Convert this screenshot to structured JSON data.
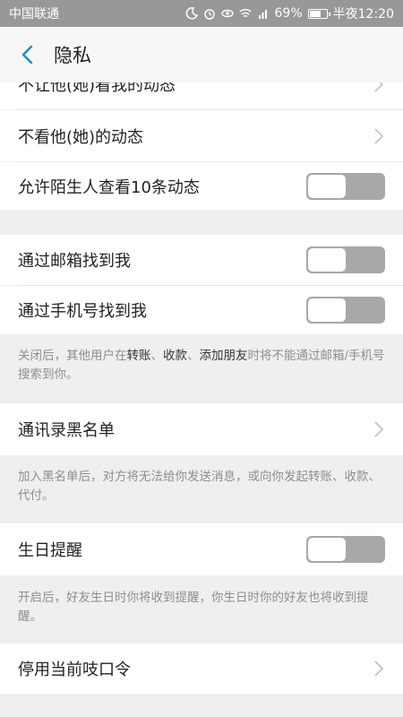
{
  "status_bar": {
    "carrier": "中国联通",
    "battery": "69%",
    "battery_level": 0.69,
    "time": "半夜12:20"
  },
  "header": {
    "title": "隐私"
  },
  "rows": {
    "hide_my_moments": "不让他(她)看我的动态",
    "hide_their_moments": "不看他(她)的动态",
    "allow_strangers": "允许陌生人查看10条动态",
    "find_by_email": "通过邮箱找到我",
    "find_by_phone": "通过手机号找到我",
    "blacklist": "通讯录黑名单",
    "birthday": "生日提醒",
    "disable_password": "停用当前吱口令"
  },
  "toggles": {
    "allow_strangers": false,
    "find_by_email": false,
    "find_by_phone": false,
    "birthday": false
  },
  "notes": {
    "find_note": {
      "p1": "关闭后，其他用户在",
      "k1": "转账",
      "s1": "、",
      "k2": "收款",
      "s2": "、",
      "k3": "添加朋友",
      "p2": "时将不能通过邮箱/手机号搜索到你。"
    },
    "blacklist_note": "加入黑名单后，对方将无法给你发送消息，或向你发起转账、收款、代付。",
    "birthday_note": "开启后，好友生日时你将收到提醒，你生日时你的好友也将收到提醒。"
  },
  "icons": {
    "back": "chevron-left-icon",
    "row_arrow": "chevron-right-icon"
  },
  "colors": {
    "accent": "#1a8fd5",
    "toggle_off_track": "#a8a8a8",
    "status_bar": "#989898"
  }
}
